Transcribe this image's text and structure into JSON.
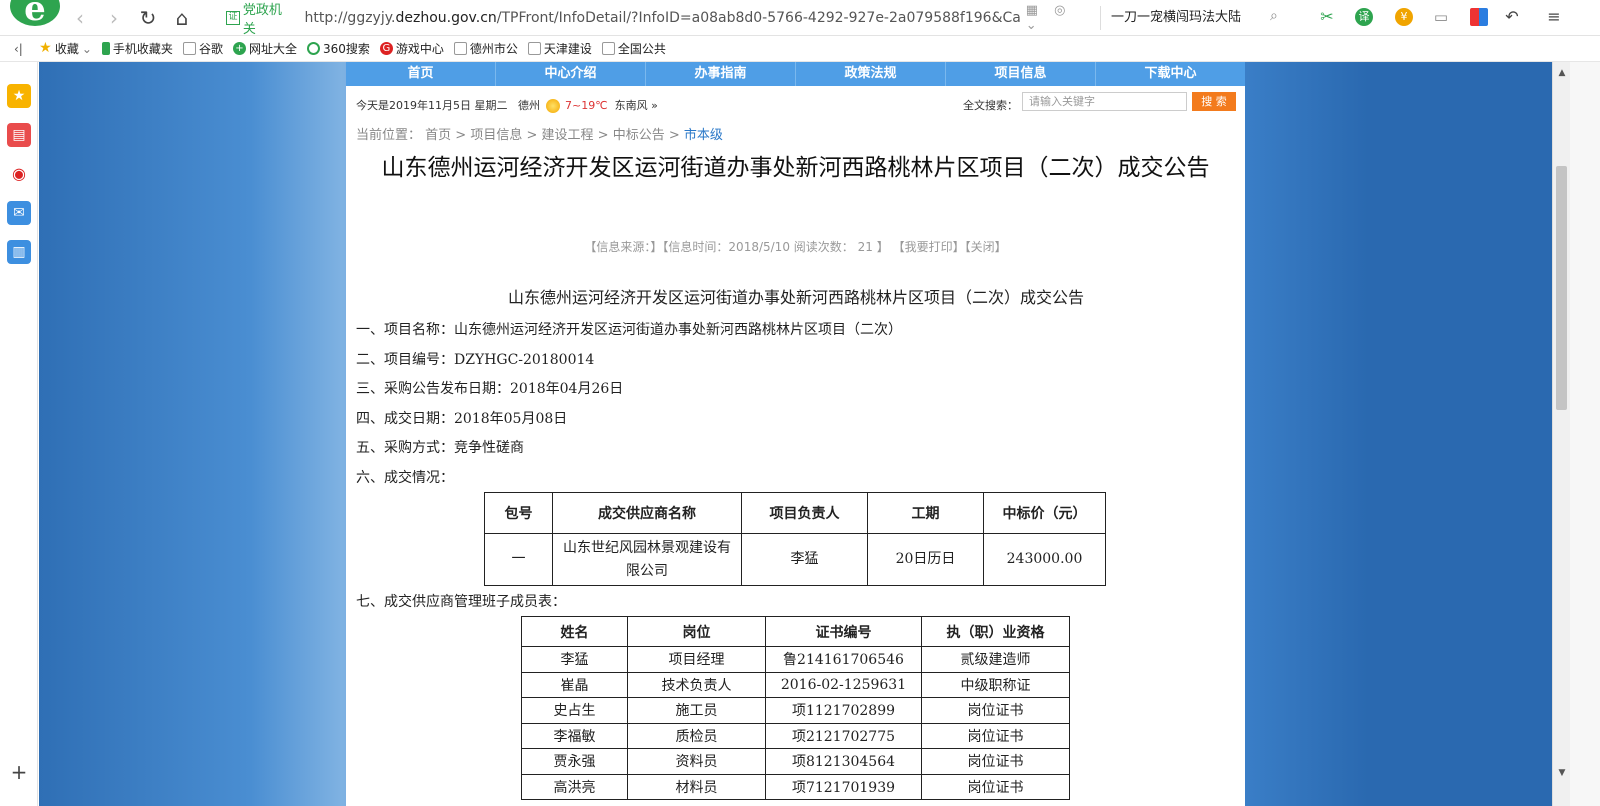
{
  "browser": {
    "address": {
      "cert_label": "党政机关",
      "url_prefix": "http://ggzyjy.",
      "url_domain": "dezhou.gov.cn",
      "url_rest": "/TPFront/InfoDetail/?InfoID=a08ab8d0-5766-4292-927e-2a079588f196&Categ"
    },
    "search_text": "一刀一宠横闯玛法大陆",
    "ext_translate": "译",
    "bookmarks": [
      {
        "label": "收藏"
      },
      {
        "label": "手机收藏夹"
      },
      {
        "label": "谷歌"
      },
      {
        "label": "网址大全"
      },
      {
        "label": "360搜索"
      },
      {
        "label": "游戏中心"
      },
      {
        "label": "德州市公"
      },
      {
        "label": "天津建设"
      },
      {
        "label": "全国公共"
      }
    ]
  },
  "site": {
    "nav": [
      "首页",
      "中心介绍",
      "办事指南",
      "政策法规",
      "项目信息",
      "下载中心"
    ],
    "date_text": "今天是2019年11月5日 星期二",
    "city": "德州",
    "temp": "7~19℃",
    "wind": "东南风",
    "fulltext_label": "全文搜索：",
    "search_placeholder": "请输入关键字",
    "search_btn": "搜 索",
    "breadcrumb": {
      "prefix": "当前位置：",
      "items": [
        "首页",
        "项目信息",
        "建设工程",
        "中标公告"
      ],
      "current": "市本级",
      "sep": " > "
    },
    "title": "山东德州运河经济开发区运河街道办事处新河西路桃林片区项目（二次）成交公告",
    "meta": {
      "source": "【信息来源：】",
      "time": "【信息时间：2018/5/10 阅读次数：",
      "reads": "21",
      "close_bracket": "】",
      "print": "【我要打印】",
      "close": "【关闭】"
    }
  },
  "article": {
    "heading": "山东德州运河经济开发区运河街道办事处新河西路桃林片区项目（二次）成交公告",
    "rows": [
      {
        "label": "一、项目名称：",
        "value": "山东德州运河经济开发区运河街道办事处新河西路桃林片区项目（二次）"
      },
      {
        "label": "二、项目编号：",
        "value": "DZYHGC-20180014"
      },
      {
        "label": "三、采购公告发布日期：",
        "value": "2018年04月26日"
      },
      {
        "label": "四、成交日期：",
        "value": "2018年05月08日"
      },
      {
        "label": "五、采购方式：",
        "value": "竞争性磋商"
      },
      {
        "label": "六、成交情况：",
        "value": ""
      }
    ],
    "deal_table": {
      "headers": [
        "包号",
        "成交供应商名称",
        "项目负责人",
        "工期",
        "中标价（元）"
      ],
      "rows": [
        [
          "一",
          "山东世纪风园林景观建设有限公司",
          "李猛",
          "20日历日",
          "243000.00"
        ]
      ]
    },
    "section7": "七、成交供应商管理班子成员表：",
    "team_table": {
      "headers": [
        "姓名",
        "岗位",
        "证书编号",
        "执（职）业资格"
      ],
      "rows": [
        [
          "李猛",
          "项目经理",
          "鲁214161706546",
          "贰级建造师"
        ],
        [
          "崔晶",
          "技术负责人",
          "2016-02-1259631",
          "中级职称证"
        ],
        [
          "史占生",
          "施工员",
          "项1121702899",
          "岗位证书"
        ],
        [
          "李福敏",
          "质检员",
          "项2121702775",
          "岗位证书"
        ],
        [
          "贾永强",
          "资料员",
          "项8121304564",
          "岗位证书"
        ],
        [
          "高洪亮",
          "材料员",
          "项7121701939",
          "岗位证书"
        ]
      ]
    }
  }
}
